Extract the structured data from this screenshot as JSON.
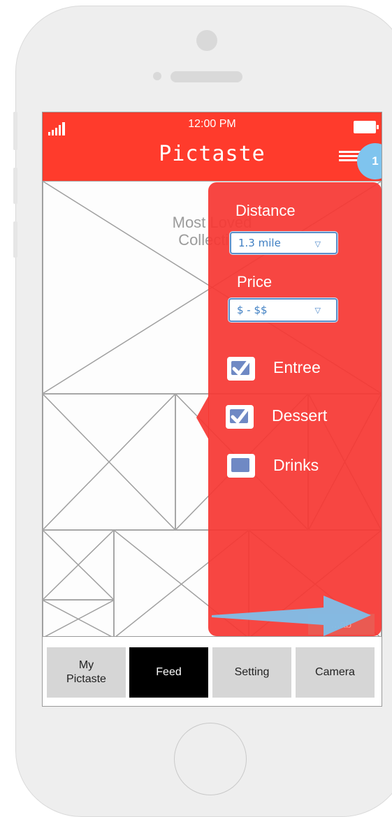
{
  "status_bar": {
    "time": "12:00 PM"
  },
  "header": {
    "title": "Pictaste",
    "notification_count": "1"
  },
  "feed": {
    "hero_label_line1": "Most Loved",
    "hero_label_line2": "Collection"
  },
  "filter_panel": {
    "distance_label": "Distance",
    "distance_value": "1.3 mile",
    "price_label": "Price",
    "price_value": "$ - $$",
    "categories": [
      {
        "label": "Entree",
        "checked": true
      },
      {
        "label": "Dessert",
        "checked": true
      },
      {
        "label": "Drinks",
        "checked": false
      }
    ],
    "hidden_action_label": "...ab"
  },
  "tab_bar": {
    "tabs": [
      {
        "label": "My\nPictaste",
        "active": false
      },
      {
        "label": "Feed",
        "active": true
      },
      {
        "label": "Setting",
        "active": false
      },
      {
        "label": "Camera",
        "active": false
      }
    ]
  },
  "colors": {
    "header": "#ff3b2c",
    "panel": "#f63834",
    "badge": "#7fc4ee",
    "arrow": "#7fbfe9",
    "active_tab": "#000000",
    "tab": "#d6d6d6"
  },
  "icons": [
    "signal-icon",
    "battery-icon",
    "menu-icon",
    "chevron-down-icon",
    "checkmark-icon",
    "arrow-icon"
  ]
}
